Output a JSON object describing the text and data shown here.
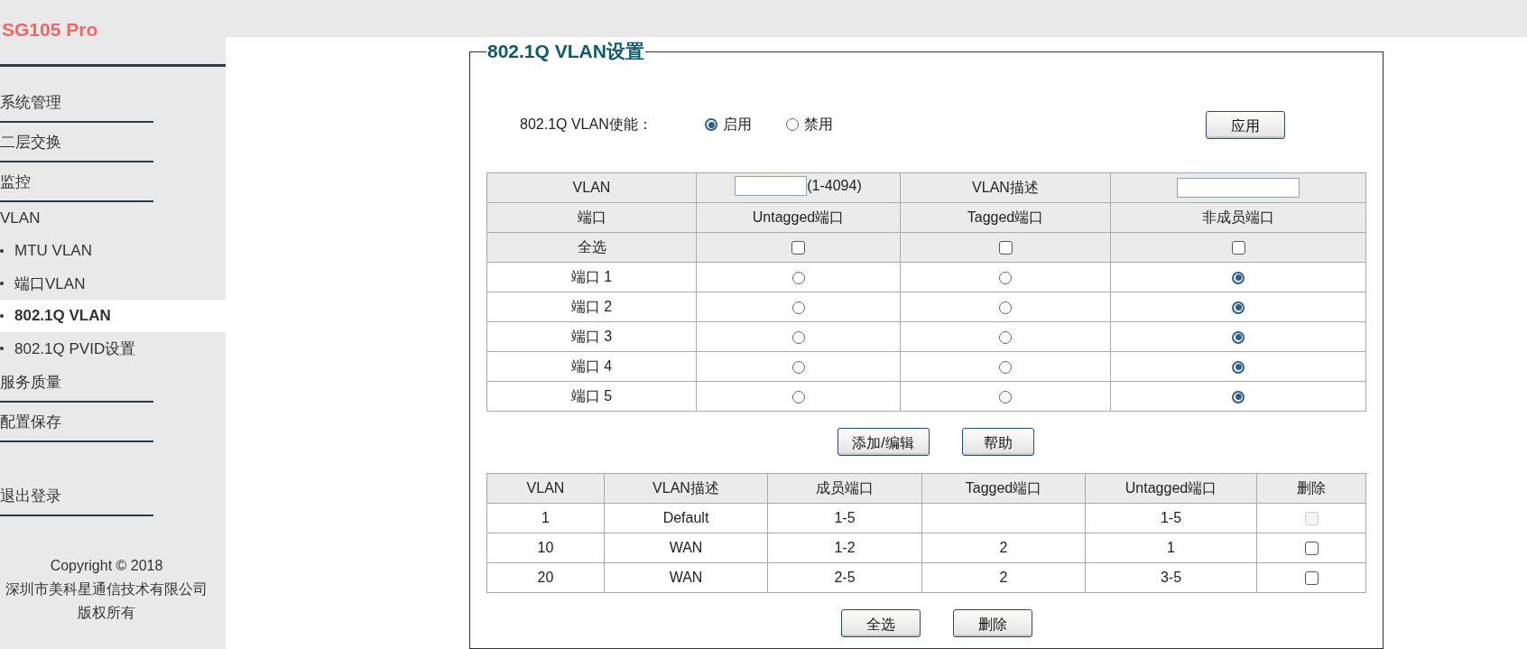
{
  "brand": "SG105 Pro",
  "sidebar": {
    "items": [
      {
        "kind": "menu",
        "label": "系统管理",
        "selected": false
      },
      {
        "kind": "menu",
        "label": "二层交换",
        "selected": false
      },
      {
        "kind": "menu",
        "label": "监控",
        "selected": false
      },
      {
        "kind": "group",
        "label": "VLAN",
        "selected": false
      },
      {
        "kind": "sub",
        "label": "MTU VLAN",
        "selected": false
      },
      {
        "kind": "sub",
        "label": "端口VLAN",
        "selected": false
      },
      {
        "kind": "sub",
        "label": "802.1Q VLAN",
        "selected": true
      },
      {
        "kind": "sub",
        "label": "802.1Q PVID设置",
        "selected": false
      },
      {
        "kind": "menu",
        "label": "服务质量",
        "selected": false
      },
      {
        "kind": "menu",
        "label": "配置保存",
        "selected": false
      },
      {
        "kind": "logout",
        "label": "退出登录",
        "selected": false
      }
    ],
    "copyright": [
      "Copyright © 2018",
      "深圳市美科星通信技术有限公司",
      "版权所有"
    ]
  },
  "panel": {
    "title": "802.1Q VLAN设置",
    "enable": {
      "label": "802.1Q VLAN使能：",
      "options": [
        {
          "label": "启用",
          "selected": true
        },
        {
          "label": "禁用",
          "selected": false
        }
      ],
      "apply": "应用"
    },
    "form": {
      "vlan_label": "VLAN",
      "vlan_range": "(1-4094)",
      "desc_label": "VLAN描述",
      "columns": [
        "端口",
        "Untagged端口",
        "Tagged端口",
        "非成员端口"
      ],
      "select_all": {
        "label": "全选",
        "untagged": false,
        "tagged": false,
        "non_member": false
      },
      "ports": [
        {
          "label": "端口 1",
          "untagged": false,
          "tagged": false,
          "non_member": true
        },
        {
          "label": "端口 2",
          "untagged": false,
          "tagged": false,
          "non_member": true
        },
        {
          "label": "端口 3",
          "untagged": false,
          "tagged": false,
          "non_member": true
        },
        {
          "label": "端口 4",
          "untagged": false,
          "tagged": false,
          "non_member": true
        },
        {
          "label": "端口 5",
          "untagged": false,
          "tagged": false,
          "non_member": true
        }
      ],
      "buttons": [
        "添加/编辑",
        "帮助"
      ]
    },
    "table": {
      "columns": [
        "VLAN",
        "VLAN描述",
        "成员端口",
        "Tagged端口",
        "Untagged端口",
        "删除"
      ],
      "rows": [
        {
          "vlan": "1",
          "desc": "Default",
          "members": "1-5",
          "tagged": "",
          "untagged": "1-5",
          "checked": false,
          "disabled": true
        },
        {
          "vlan": "10",
          "desc": "WAN",
          "members": "1-2",
          "tagged": "2",
          "untagged": "1",
          "checked": false,
          "disabled": false
        },
        {
          "vlan": "20",
          "desc": "WAN",
          "members": "2-5",
          "tagged": "2",
          "untagged": "3-5",
          "checked": false,
          "disabled": false
        }
      ],
      "buttons": [
        "全选",
        "删除"
      ]
    }
  }
}
